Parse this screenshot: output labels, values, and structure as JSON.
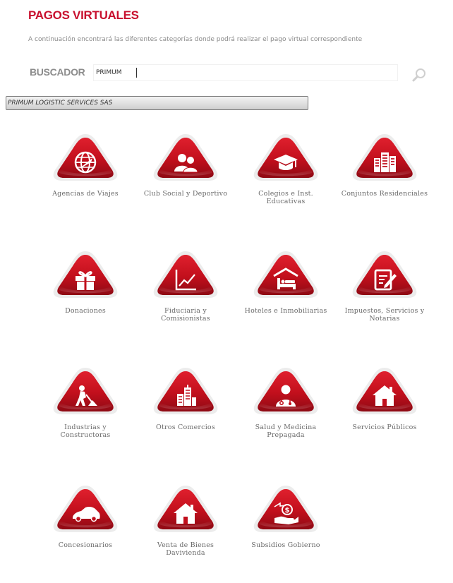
{
  "header": {
    "title": "PAGOS VIRTUALES",
    "subtitle": "A continuación encontrará las diferentes categorías donde podrá realizar el pago virtual correspondiente"
  },
  "search": {
    "label": "BUSCADOR",
    "value": "PRIMUM",
    "suggestion": "PRIMUM LOGISTIC SERVICES SAS"
  },
  "colors": {
    "brand_red": "#c8102e",
    "dark_red": "#8e0a14",
    "halo": "#ececec"
  },
  "categories": [
    {
      "label": "Agencias de Viajes",
      "icon": "globe-plane-icon"
    },
    {
      "label": "Club Social y Deportivo",
      "icon": "users-icon"
    },
    {
      "label": "Colegios e Inst. Educativas",
      "icon": "graduation-cap-icon"
    },
    {
      "label": "Conjuntos Residenciales",
      "icon": "buildings-icon"
    },
    {
      "label": "Donaciones",
      "icon": "gift-icon"
    },
    {
      "label": "Fiduciaria y Comisionistas",
      "icon": "chart-icon"
    },
    {
      "label": "Hoteles e Inmobiliarias",
      "icon": "bed-icon"
    },
    {
      "label": "Impuestos, Servicios y Notarias",
      "icon": "edit-document-icon"
    },
    {
      "label": "Industrias y Constructoras",
      "icon": "worker-icon"
    },
    {
      "label": "Otros Comercios",
      "icon": "city-icon"
    },
    {
      "label": "Salud y Medicina Prepagada",
      "icon": "doctor-icon"
    },
    {
      "label": "Servicios Públicos",
      "icon": "house-icon"
    },
    {
      "label": "Concesionarios",
      "icon": "car-icon"
    },
    {
      "label": "Venta de Bienes Davivienda",
      "icon": "house-icon"
    },
    {
      "label": "Subsidios Gobierno",
      "icon": "hand-money-icon"
    }
  ]
}
